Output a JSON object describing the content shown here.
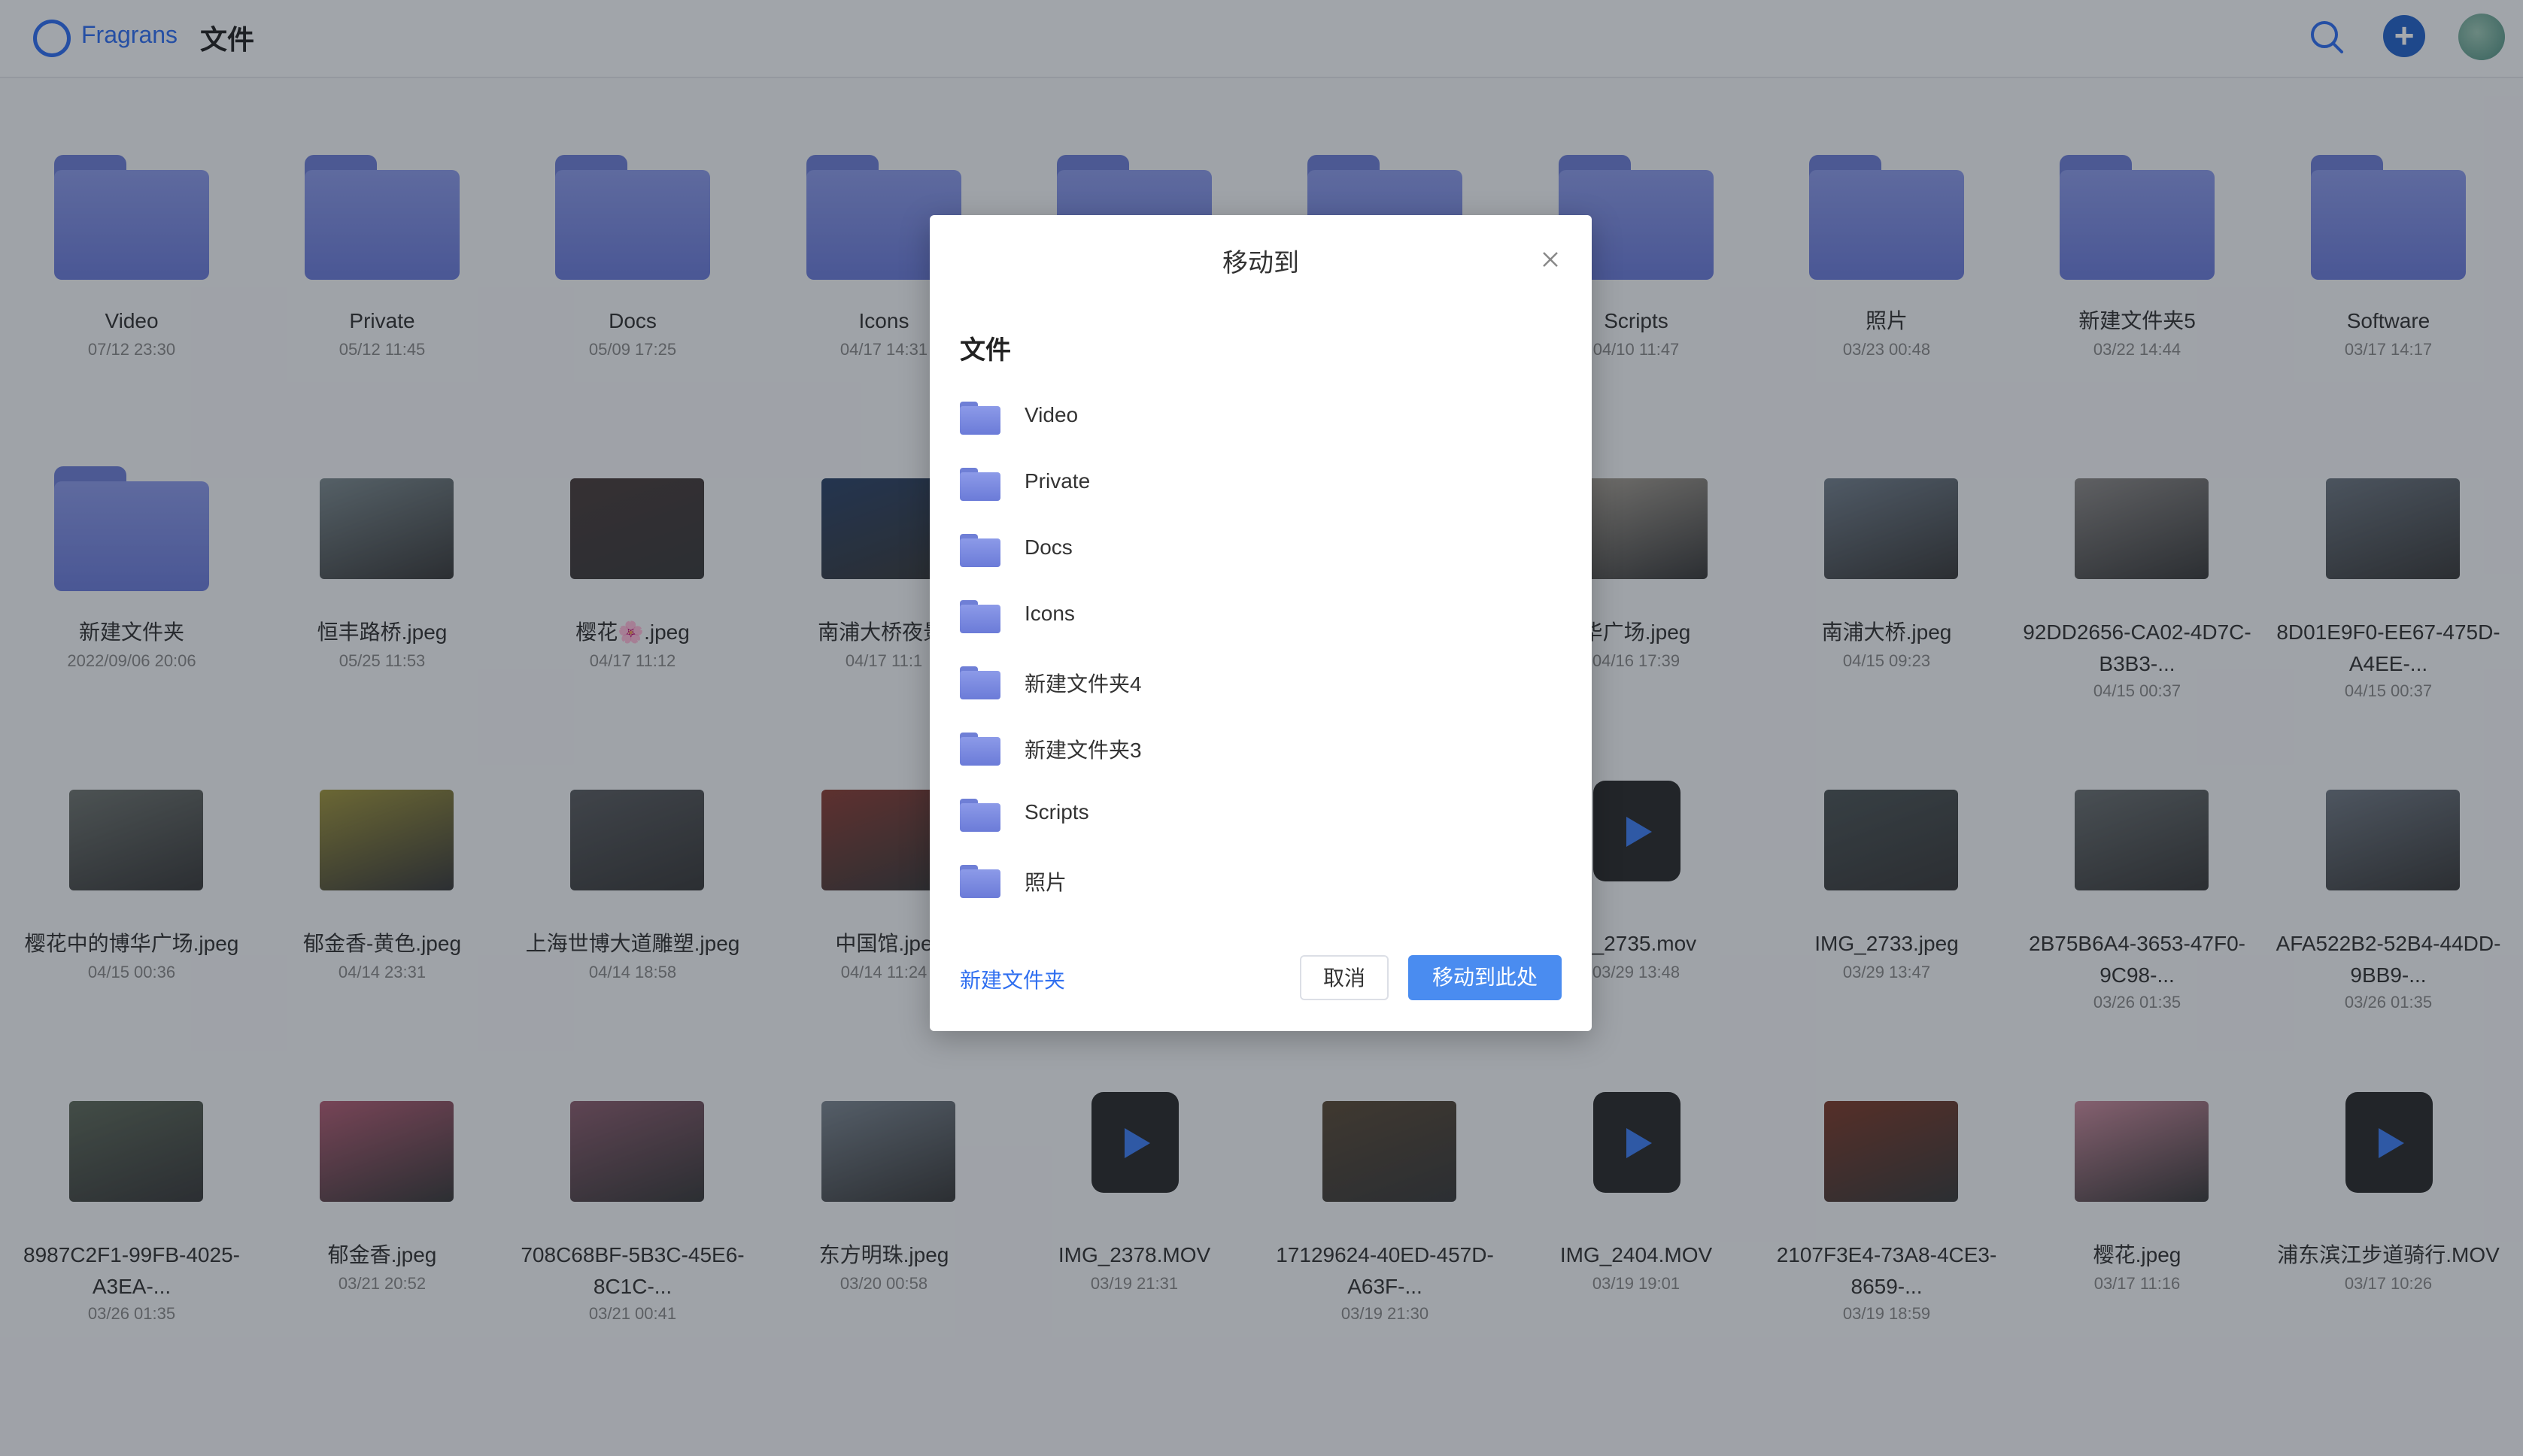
{
  "app": {
    "brand": "Fragrans",
    "breadcrumb": "文件"
  },
  "files": [
    {
      "name": "Video",
      "date": "07/12 23:30",
      "kind": "folder"
    },
    {
      "name": "Private",
      "date": "05/12 11:45",
      "kind": "folder"
    },
    {
      "name": "Docs",
      "date": "05/09 17:25",
      "kind": "folder"
    },
    {
      "name": "Icons",
      "date": "04/17 14:31",
      "kind": "folder"
    },
    {
      "name": "",
      "date": "",
      "kind": "folder"
    },
    {
      "name": "",
      "date": "",
      "kind": "folder"
    },
    {
      "name": "Scripts",
      "date": "04/10 11:47",
      "kind": "folder"
    },
    {
      "name": "照片",
      "date": "03/23 00:48",
      "kind": "folder"
    },
    {
      "name": "新建文件夹5",
      "date": "03/22 14:44",
      "kind": "folder"
    },
    {
      "name": "Software",
      "date": "03/17 14:17",
      "kind": "folder"
    },
    {
      "name": "新建文件夹",
      "date": "2022/09/06 20:06",
      "kind": "folder"
    },
    {
      "name": "恒丰路桥.jpeg",
      "date": "05/25 11:53",
      "kind": "image",
      "color": "#7d8a8e"
    },
    {
      "name": "樱花🌸.jpeg",
      "date": "04/17 11:12",
      "kind": "image",
      "color": "#4a3c3a"
    },
    {
      "name": "南浦大桥夜景.",
      "date": "04/17 11:1",
      "kind": "image",
      "color": "#2d4468"
    },
    {
      "name": "",
      "date": "",
      "kind": "empty"
    },
    {
      "name": "",
      "date": "",
      "kind": "empty"
    },
    {
      "name": "华广场.jpeg",
      "date": "04/16 17:39",
      "kind": "image",
      "color": "#a9a297"
    },
    {
      "name": "南浦大桥.jpeg",
      "date": "04/15 09:23",
      "kind": "image",
      "color": "#74808c"
    },
    {
      "name": "92DD2656-CA02-4D7C-B3B3-...",
      "date": "04/15 00:37",
      "kind": "image",
      "color": "#8d8a88"
    },
    {
      "name": "8D01E9F0-EE67-475D-A4EE-...",
      "date": "04/15 00:37",
      "kind": "image",
      "color": "#6d7680"
    },
    {
      "name": "樱花中的博华广场.jpeg",
      "date": "04/15 00:36",
      "kind": "image",
      "color": "#6f746f"
    },
    {
      "name": "郁金香-黄色.jpeg",
      "date": "04/14 23:31",
      "kind": "image",
      "color": "#a0953c"
    },
    {
      "name": "上海世博大道雕塑.jpeg",
      "date": "04/14 18:58",
      "kind": "image",
      "color": "#5b5d60"
    },
    {
      "name": "中国馆.jpe",
      "date": "04/14 11:24",
      "kind": "image",
      "color": "#8b3e35"
    },
    {
      "name": "",
      "date": "",
      "kind": "empty"
    },
    {
      "name": "",
      "date": "",
      "kind": "empty"
    },
    {
      "name": "G_2735.mov",
      "date": "03/29 13:48",
      "kind": "video"
    },
    {
      "name": "IMG_2733.jpeg",
      "date": "03/29 13:47",
      "kind": "image",
      "color": "#4d5556"
    },
    {
      "name": "2B75B6A4-3653-47F0-9C98-...",
      "date": "03/26 01:35",
      "kind": "image",
      "color": "#6a6f70"
    },
    {
      "name": "AFA522B2-52B4-44DD-9BB9-...",
      "date": "03/26 01:35",
      "kind": "image",
      "color": "#717983"
    },
    {
      "name": "8987C2F1-99FB-4025-A3EA-...",
      "date": "03/26 01:35",
      "kind": "image",
      "color": "#5f6a5a"
    },
    {
      "name": "郁金香.jpeg",
      "date": "03/21 20:52",
      "kind": "image",
      "color": "#b35d74"
    },
    {
      "name": "708C68BF-5B3C-45E6-8C1C-...",
      "date": "03/21 00:41",
      "kind": "image",
      "color": "#8c5d6e"
    },
    {
      "name": "东方明珠.jpeg",
      "date": "03/20 00:58",
      "kind": "image",
      "color": "#7c8690"
    },
    {
      "name": "IMG_2378.MOV",
      "date": "03/19 21:31",
      "kind": "video"
    },
    {
      "name": "17129624-40ED-457D-A63F-...",
      "date": "03/19 21:30",
      "kind": "image",
      "color": "#5a4a36"
    },
    {
      "name": "IMG_2404.MOV",
      "date": "03/19 19:01",
      "kind": "video"
    },
    {
      "name": "2107F3E4-73A8-4CE3-8659-...",
      "date": "03/19 18:59",
      "kind": "image",
      "color": "#7e3a2a"
    },
    {
      "name": "樱花.jpeg",
      "date": "03/17 11:16",
      "kind": "image",
      "color": "#c98a9c"
    },
    {
      "name": "浦东滨江步道骑行.MOV",
      "date": "03/17 10:26",
      "kind": "video"
    }
  ],
  "dialog": {
    "title": "移动到",
    "path": "文件",
    "folders": [
      "Video",
      "Private",
      "Docs",
      "Icons",
      "新建文件夹4",
      "新建文件夹3",
      "Scripts",
      "照片"
    ],
    "new_folder_label": "新建文件夹",
    "cancel_label": "取消",
    "confirm_label": "移动到此处"
  }
}
